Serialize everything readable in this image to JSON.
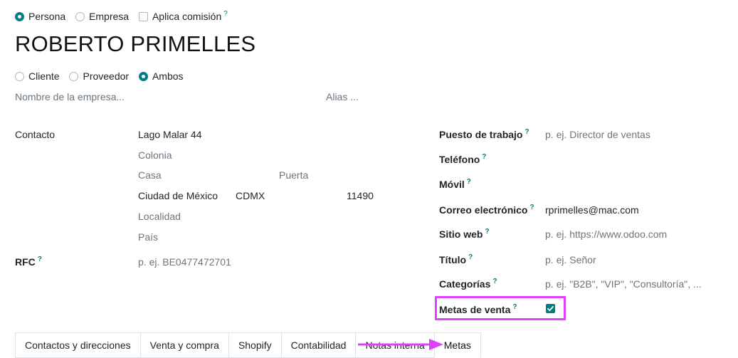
{
  "type_options": [
    {
      "label": "Persona",
      "selected": true
    },
    {
      "label": "Empresa",
      "selected": false
    }
  ],
  "commission": {
    "label": "Aplica comisión",
    "help": "?",
    "checked": false
  },
  "partner_name": "ROBERTO PRIMELLES",
  "role_options": [
    {
      "label": "Cliente",
      "selected": false
    },
    {
      "label": "Proveedor",
      "selected": false
    },
    {
      "label": "Ambos",
      "selected": true
    }
  ],
  "company_placeholder": "Nombre de la empresa...",
  "alias_placeholder": "Alias ...",
  "address": {
    "label": "Contacto",
    "street": "Lago Malar 44",
    "colonia": "Colonia",
    "casa": "Casa",
    "puerta": "Puerta",
    "city": "Ciudad de México",
    "state": "CDMX",
    "zip": "11490",
    "localidad": "Localidad",
    "pais": "País"
  },
  "rfc": {
    "label": "RFC",
    "help": "?",
    "placeholder": "p. ej. BE0477472701"
  },
  "right_fields": {
    "puesto": {
      "label": "Puesto de trabajo",
      "help": "?",
      "placeholder": "p. ej. Director de ventas"
    },
    "telefono": {
      "label": "Teléfono",
      "help": "?"
    },
    "movil": {
      "label": "Móvil",
      "help": "?"
    },
    "correo": {
      "label": "Correo electrónico",
      "help": "?",
      "value": "rprimelles@mac.com"
    },
    "sitio": {
      "label": "Sitio web",
      "help": "?",
      "placeholder": "p. ej. https://www.odoo.com"
    },
    "titulo": {
      "label": "Título",
      "help": "?",
      "placeholder": "p. ej. Señor"
    },
    "categorias": {
      "label": "Categorías",
      "help": "?",
      "placeholder": "p. ej. \"B2B\", \"VIP\", \"Consultoría\", ..."
    },
    "metas": {
      "label": "Metas de venta",
      "help": "?",
      "checked": true
    }
  },
  "tabs": [
    {
      "label": "Contactos y direcciones",
      "active": false
    },
    {
      "label": "Venta y compra",
      "active": false
    },
    {
      "label": "Shopify",
      "active": false
    },
    {
      "label": "Contabilidad",
      "active": false
    },
    {
      "label": "Notas interna",
      "active": false
    },
    {
      "label": "Metas",
      "active": true
    }
  ],
  "colors": {
    "accent": "#017e84",
    "highlight": "#e040fb"
  }
}
